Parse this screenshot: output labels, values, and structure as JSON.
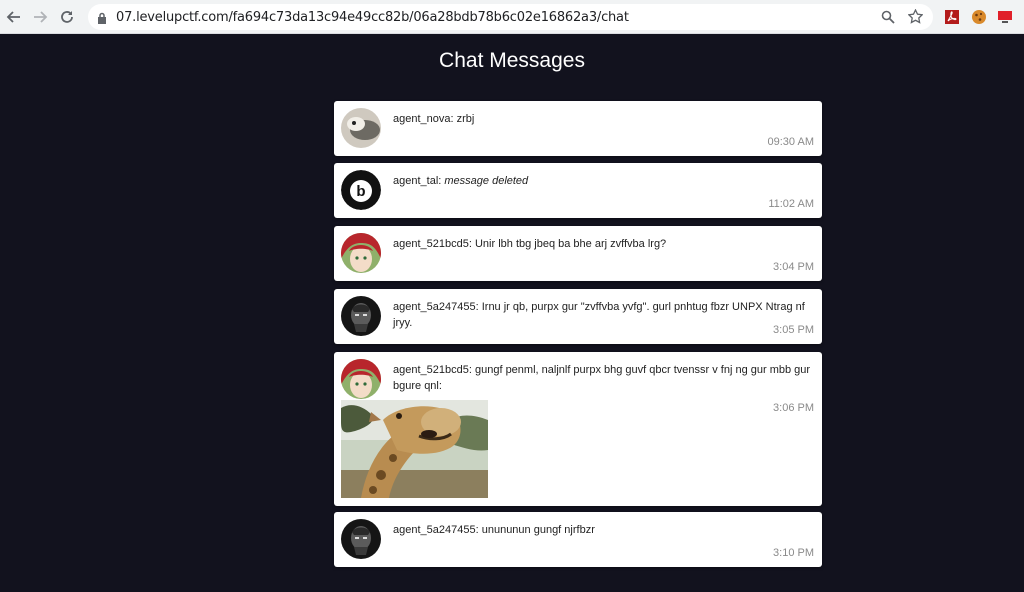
{
  "browser": {
    "url": "07.levelupctf.com/fa694c73da13c94e49cc82b/06a28bdb78b6c02e16862a3/chat"
  },
  "page": {
    "title": "Chat Messages"
  },
  "messages": [
    {
      "author": "agent_nova",
      "text": "zrbj",
      "time": "09:30 AM"
    },
    {
      "author": "agent_tal",
      "text": "message deleted",
      "time": "11:02 AM"
    },
    {
      "author": "agent_521bcd5",
      "text": "Unir lbh tbg jbeq ba bhe arj zvffvba lrg?",
      "time": "3:04 PM"
    },
    {
      "author": "agent_5a247455",
      "text": "Irnu jr qb, purpx gur \"zvffvba yvfg\". gurl pnhtug fbzr UNPX Ntrag nf jryy.",
      "time": "3:05 PM"
    },
    {
      "author": "agent_521bcd5",
      "text": "gungf penml, naljnlf purpx bhg guvf qbcr tvenssr v fnj ng gur mbb gur bgure qnl:",
      "time": "3:06 PM"
    },
    {
      "author": "agent_5a247455",
      "text": "unununun gungf njrfbzr",
      "time": "3:10 PM"
    }
  ],
  "colors": {
    "background": "#12121e",
    "card": "#ffffff",
    "timestamp": "#8a8a8a"
  }
}
